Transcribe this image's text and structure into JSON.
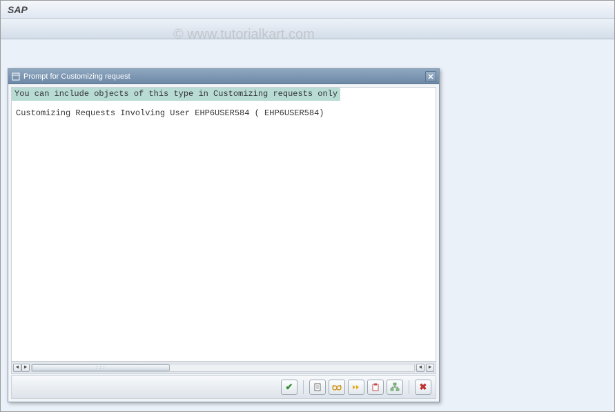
{
  "app": {
    "title": "SAP"
  },
  "watermark": "© www.tutorialkart.com",
  "dialog": {
    "title": "Prompt for Customizing request",
    "message_highlight": "You can include objects of this type in Customizing requests only",
    "message_line2": "Customizing Requests Involving User EHP6USER584 ( EHP6USER584)"
  }
}
